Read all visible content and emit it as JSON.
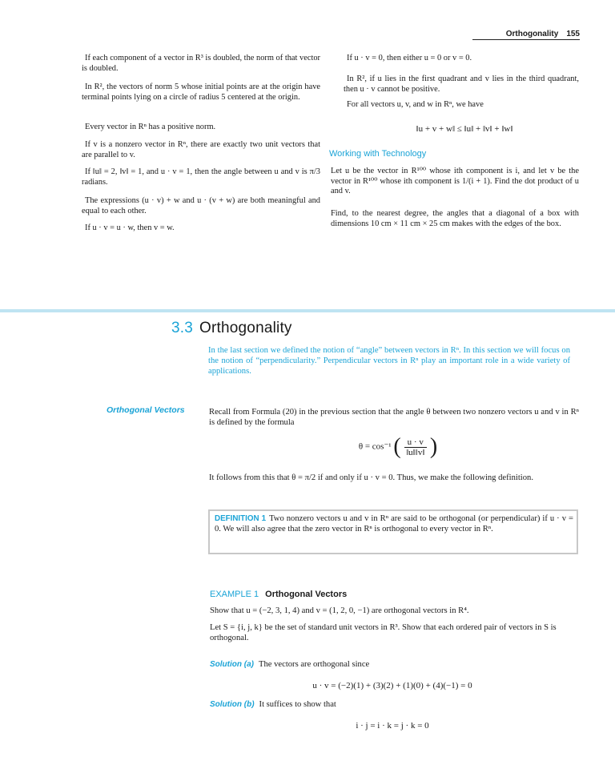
{
  "page_header": {
    "title": "Orthogonality",
    "page_number": "155"
  },
  "exercises_left": [
    {
      "num": "",
      "tf": "",
      "text": "If each component of a vector in R³ is doubled, the norm of that vector is doubled."
    },
    {
      "num": "",
      "tf": "",
      "text": "In R², the vectors of norm 5 whose initial points are at the origin have terminal points lying on a circle of radius 5 centered at the origin."
    },
    {
      "num": "",
      "tf": "",
      "text": "Every vector in Rⁿ has a positive norm."
    },
    {
      "num": "",
      "tf": "",
      "text": "If v is a nonzero vector in Rⁿ, there are exactly two unit vectors that are parallel to v."
    },
    {
      "num": "",
      "tf": "",
      "text": "If ‖u‖ = 2, ‖v‖ = 1, and u · v = 1, then the angle between u and v is π/3 radians."
    },
    {
      "num": "",
      "tf": "",
      "text": "The expressions (u · v) + w and u · (v + w) are both meaningful and equal to each other."
    },
    {
      "num": "",
      "tf": "",
      "text": "If u · v = u · w, then v = w."
    }
  ],
  "exercises_right": [
    {
      "num": "",
      "tf": "",
      "text": "If u · v = 0, then either u = 0 or v = 0."
    },
    {
      "num": "",
      "tf": "",
      "text": "In R², if u lies in the first quadrant and v lies in the third quadrant, then u · v cannot be positive."
    },
    {
      "num": "",
      "tf": "",
      "text": "For all vectors u, v, and w in Rⁿ, we have"
    }
  ],
  "exercise_equation": "‖u + v + w‖ ≤ ‖u‖ + ‖v‖ + ‖w‖",
  "tech_heading": "Working with Technology",
  "tech_items": [
    "Let u be the vector in R¹⁰⁰ whose ith component is i, and let v be the vector in R¹⁰⁰ whose ith component is 1/(i + 1). Find the dot product of u and v.",
    "Find, to the nearest degree, the angles that a diagonal of a box with dimensions 10 cm × 11 cm × 25 cm makes with the edges of the box."
  ],
  "section": {
    "number": "3.3",
    "title": "Orthogonality"
  },
  "intro": "In the last section we defined the notion of “angle” between vectors in Rⁿ. In this section we will focus on the notion of “perpendicularity.” Perpendicular vectors in Rⁿ play an important role in a wide variety of applications.",
  "margin_heading": "Orthogonal Vectors",
  "para_recall": "Recall from Formula (20) in the previous section that the angle θ between two nonzero vectors u and v in Rⁿ is defined by the formula",
  "formula": {
    "lhs": "θ = cos⁻¹",
    "num": "u · v",
    "den": "‖u‖‖v‖"
  },
  "para_follows": "It follows from this that θ = π/2 if and only if u · v = 0. Thus, we make the following definition.",
  "definition": {
    "label": "DEFINITION 1",
    "text": "Two nonzero vectors u and v in Rⁿ are said to be orthogonal (or perpendicular) if u · v = 0. We will also agree that the zero vector in Rⁿ is orthogonal to every vector in Rⁿ."
  },
  "example": {
    "label": "EXAMPLE 1",
    "title": "Orthogonal Vectors"
  },
  "example_items": [
    "Show that u = (−2, 3, 1, 4) and v = (1, 2, 0, −1) are orthogonal vectors in R⁴.",
    "Let S = {i, j, k} be the set of standard unit vectors in R³. Show that each ordered pair of vectors in S is orthogonal."
  ],
  "solution_a": {
    "label": "Solution (a)",
    "text": "The vectors are orthogonal since"
  },
  "equation_a": "u · v = (−2)(1) + (3)(2) + (1)(0) + (4)(−1) = 0",
  "solution_b": {
    "label": "Solution (b)",
    "text": "It suffices to show that"
  },
  "equation_b": "i · j = i · k = j · k = 0",
  "colors": {
    "accent": "#1aa3d6",
    "band": "#bfe4f2",
    "box_border": "#c8c8c8"
  }
}
